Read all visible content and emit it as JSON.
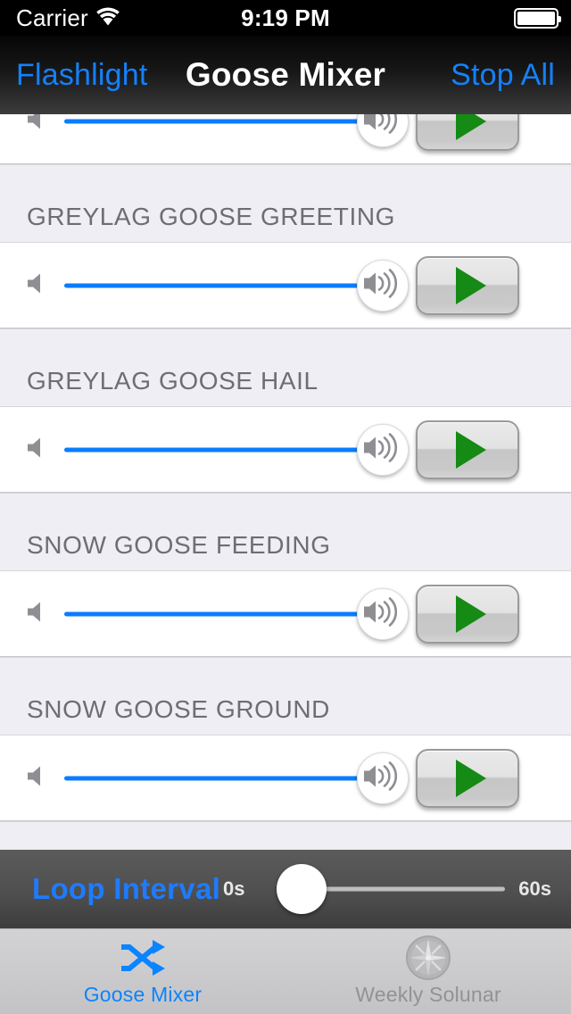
{
  "status_bar": {
    "carrier": "Carrier",
    "wifi_icon": "wifi-icon",
    "time": "9:19 PM",
    "battery_icon": "battery-full-icon"
  },
  "nav_bar": {
    "back_label": "Flashlight",
    "title": "Goose Mixer",
    "action_label": "Stop All"
  },
  "list": {
    "partial_top_row": {
      "min_icon": "speaker-mute-icon",
      "max_icon": "speaker-volume-icon",
      "play_icon": "play-icon",
      "volume_percent": 88
    },
    "sections": [
      {
        "header": "GREYLAG GOOSE GREETING",
        "min_icon": "speaker-mute-icon",
        "max_icon": "speaker-volume-icon",
        "play_icon": "play-icon",
        "volume_percent": 88
      },
      {
        "header": "GREYLAG GOOSE HAIL",
        "min_icon": "speaker-mute-icon",
        "max_icon": "speaker-volume-icon",
        "play_icon": "play-icon",
        "volume_percent": 88
      },
      {
        "header": "SNOW GOOSE FEEDING",
        "min_icon": "speaker-mute-icon",
        "max_icon": "speaker-volume-icon",
        "play_icon": "play-icon",
        "volume_percent": 88
      },
      {
        "header": "SNOW GOOSE GROUND",
        "min_icon": "speaker-mute-icon",
        "max_icon": "speaker-volume-icon",
        "play_icon": "play-icon",
        "volume_percent": 88
      }
    ]
  },
  "loop_bar": {
    "label": "Loop Interval",
    "min_label": "0s",
    "max_label": "60s",
    "value_percent": 0
  },
  "tab_bar": {
    "tabs": [
      {
        "label": "Goose Mixer",
        "icon": "shuffle-icon",
        "active": true
      },
      {
        "label": "Weekly Solunar",
        "icon": "compass-icon",
        "active": false
      }
    ]
  },
  "colors": {
    "accent_blue": "#0a84ff",
    "nav_blue": "#1481fb",
    "slider_blue": "#0a7cff",
    "play_green": "#158a15",
    "header_bg": "#efeef4",
    "header_text": "#6d6d72",
    "loop_bar_bg": "#4f4f4f"
  }
}
